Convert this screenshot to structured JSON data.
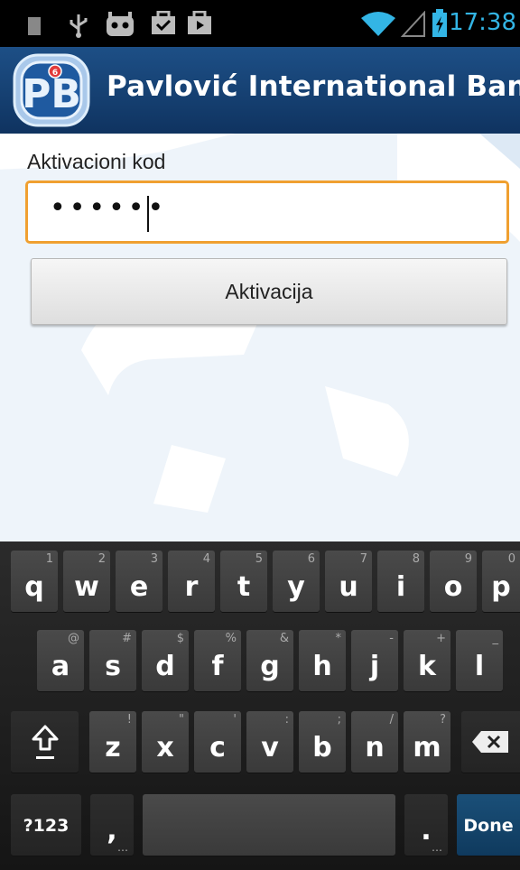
{
  "status_bar": {
    "time": "17:38",
    "icons": [
      "sd-card-icon",
      "usb-icon",
      "android-debug-icon",
      "checklist-icon",
      "play-store-icon",
      "wifi-icon",
      "signal-icon",
      "battery-charging-icon"
    ]
  },
  "header": {
    "title": "Pavlović International Bank",
    "logo_text": "PB",
    "colors": {
      "background": "#1a4a80",
      "accent": "#e23a3a"
    }
  },
  "form": {
    "label": "Aktivacioni kod",
    "input_value": "••••••",
    "button_label": "Aktivacija",
    "focus_color": "#f0a030"
  },
  "keyboard": {
    "row1": [
      {
        "key": "q",
        "hint": "1"
      },
      {
        "key": "w",
        "hint": "2"
      },
      {
        "key": "e",
        "hint": "3"
      },
      {
        "key": "r",
        "hint": "4"
      },
      {
        "key": "t",
        "hint": "5"
      },
      {
        "key": "y",
        "hint": "6"
      },
      {
        "key": "u",
        "hint": "7"
      },
      {
        "key": "i",
        "hint": "8"
      },
      {
        "key": "o",
        "hint": "9"
      },
      {
        "key": "p",
        "hint": "0"
      }
    ],
    "row2": [
      {
        "key": "a",
        "hint": "@"
      },
      {
        "key": "s",
        "hint": "#"
      },
      {
        "key": "d",
        "hint": "$"
      },
      {
        "key": "f",
        "hint": "%"
      },
      {
        "key": "g",
        "hint": "&"
      },
      {
        "key": "h",
        "hint": "*"
      },
      {
        "key": "j",
        "hint": "-"
      },
      {
        "key": "k",
        "hint": "+"
      },
      {
        "key": "l",
        "hint": "_"
      }
    ],
    "row3": [
      {
        "key": "z",
        "hint": "!"
      },
      {
        "key": "x",
        "hint": "\""
      },
      {
        "key": "c",
        "hint": "'"
      },
      {
        "key": "v",
        "hint": ":"
      },
      {
        "key": "b",
        "hint": ";"
      },
      {
        "key": "n",
        "hint": "/"
      },
      {
        "key": "m",
        "hint": "?"
      }
    ],
    "symbols_label": "?123",
    "comma": ",",
    "period": ".",
    "done_label": "Done"
  }
}
